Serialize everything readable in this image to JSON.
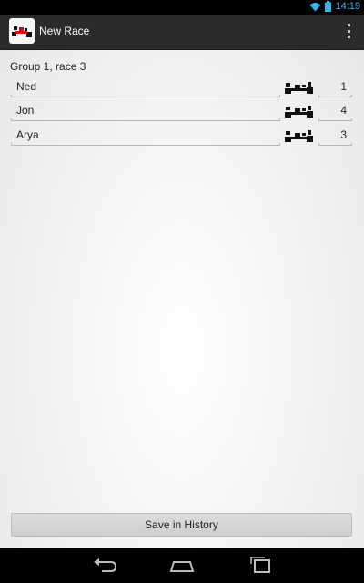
{
  "status_bar": {
    "time": "14:19",
    "icons": [
      "wifi-icon",
      "battery-icon"
    ]
  },
  "action_bar": {
    "app_icon": "kart-icon",
    "title": "New Race",
    "overflow_icon": "overflow-menu-icon"
  },
  "race": {
    "label": "Group 1, race 3",
    "racers": [
      {
        "name": "Ned",
        "position": "1",
        "icon": "kart-icon"
      },
      {
        "name": "Jon",
        "position": "4",
        "icon": "kart-icon"
      },
      {
        "name": "Arya",
        "position": "3",
        "icon": "kart-icon"
      }
    ]
  },
  "actions": {
    "save_label": "Save in History"
  },
  "nav_bar": {
    "buttons": [
      "back-icon",
      "home-icon",
      "recents-icon"
    ]
  },
  "colors": {
    "status_accent": "#33b5e5",
    "action_bar": "#2b2b2b",
    "kart_red": "#cc1111"
  }
}
